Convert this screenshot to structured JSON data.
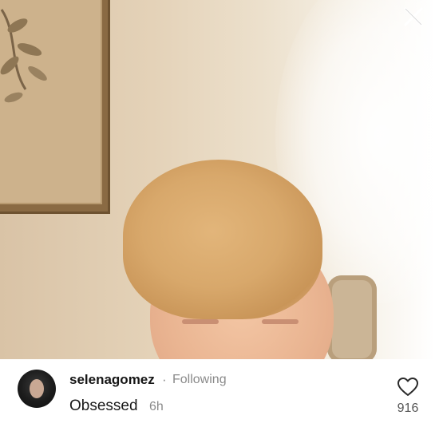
{
  "post": {
    "username": "selenagomez",
    "separator": "·",
    "follow_status": "Following",
    "caption": "Obsessed",
    "time_ago": "6h",
    "like_count": "916"
  },
  "icons": {
    "close": "close-icon",
    "like": "heart-icon",
    "avatar": "avatar"
  },
  "colors": {
    "bar_background": "#ffffff",
    "username": "#161616",
    "secondary_text": "#8a8a8a"
  }
}
